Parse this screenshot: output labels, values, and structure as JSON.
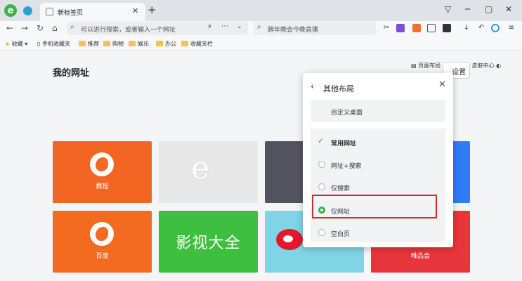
{
  "tab": {
    "title": "新标签页",
    "close": "✕"
  },
  "newtab": "+",
  "window": {
    "pin": "▽",
    "minimize": "─",
    "maximize": "▢",
    "close": "✕"
  },
  "nav": {
    "back": "←",
    "forward": "→",
    "reload": "↻",
    "home": "⌂"
  },
  "url": {
    "placeholder": "可以进行搜索，或者输入一个网址",
    "bolt": "⚡",
    "dots": "⋯",
    "chev": "⌄"
  },
  "search": {
    "text": "跨年晚会今晚直播"
  },
  "toolbar": {
    "cut": "✂",
    "download": "↓",
    "undo": "↶",
    "menu": "≡"
  },
  "bookmarks": {
    "favorites": "收藏",
    "items": [
      "手机收藏夹",
      "推荐",
      "购物",
      "娱乐",
      "办公",
      "收藏夹栏"
    ]
  },
  "page": {
    "layout_btn": "页面布局",
    "skin_btn": "皮肤中心",
    "title": "我的网址",
    "settings": "设置"
  },
  "tiles": [
    {
      "label": "携程",
      "color": "#f26522"
    },
    {
      "label": "",
      "color": "#e8e8e8"
    },
    {
      "label": "",
      "color": "#545360"
    },
    {
      "label": "百度",
      "color": "#f36b21"
    },
    {
      "label": "影视大全",
      "color": "#3fbf3f"
    },
    {
      "label": "",
      "color": "#7fd4e6"
    },
    {
      "label": "唯品会",
      "color": "#e8353b"
    }
  ],
  "popup": {
    "back": "‹",
    "title": "其他布局",
    "close": "✕",
    "custom": "自定义桌面",
    "options": [
      {
        "label": "常用网址",
        "state": "checked"
      },
      {
        "label": "网址+搜索",
        "state": "off"
      },
      {
        "label": "仅搜索",
        "state": "off"
      },
      {
        "label": "仅网址",
        "state": "selected"
      },
      {
        "label": "空白页",
        "state": "off"
      }
    ]
  },
  "colors": {
    "accent_green": "#2bb34a",
    "highlight_red": "#d42a2a"
  }
}
